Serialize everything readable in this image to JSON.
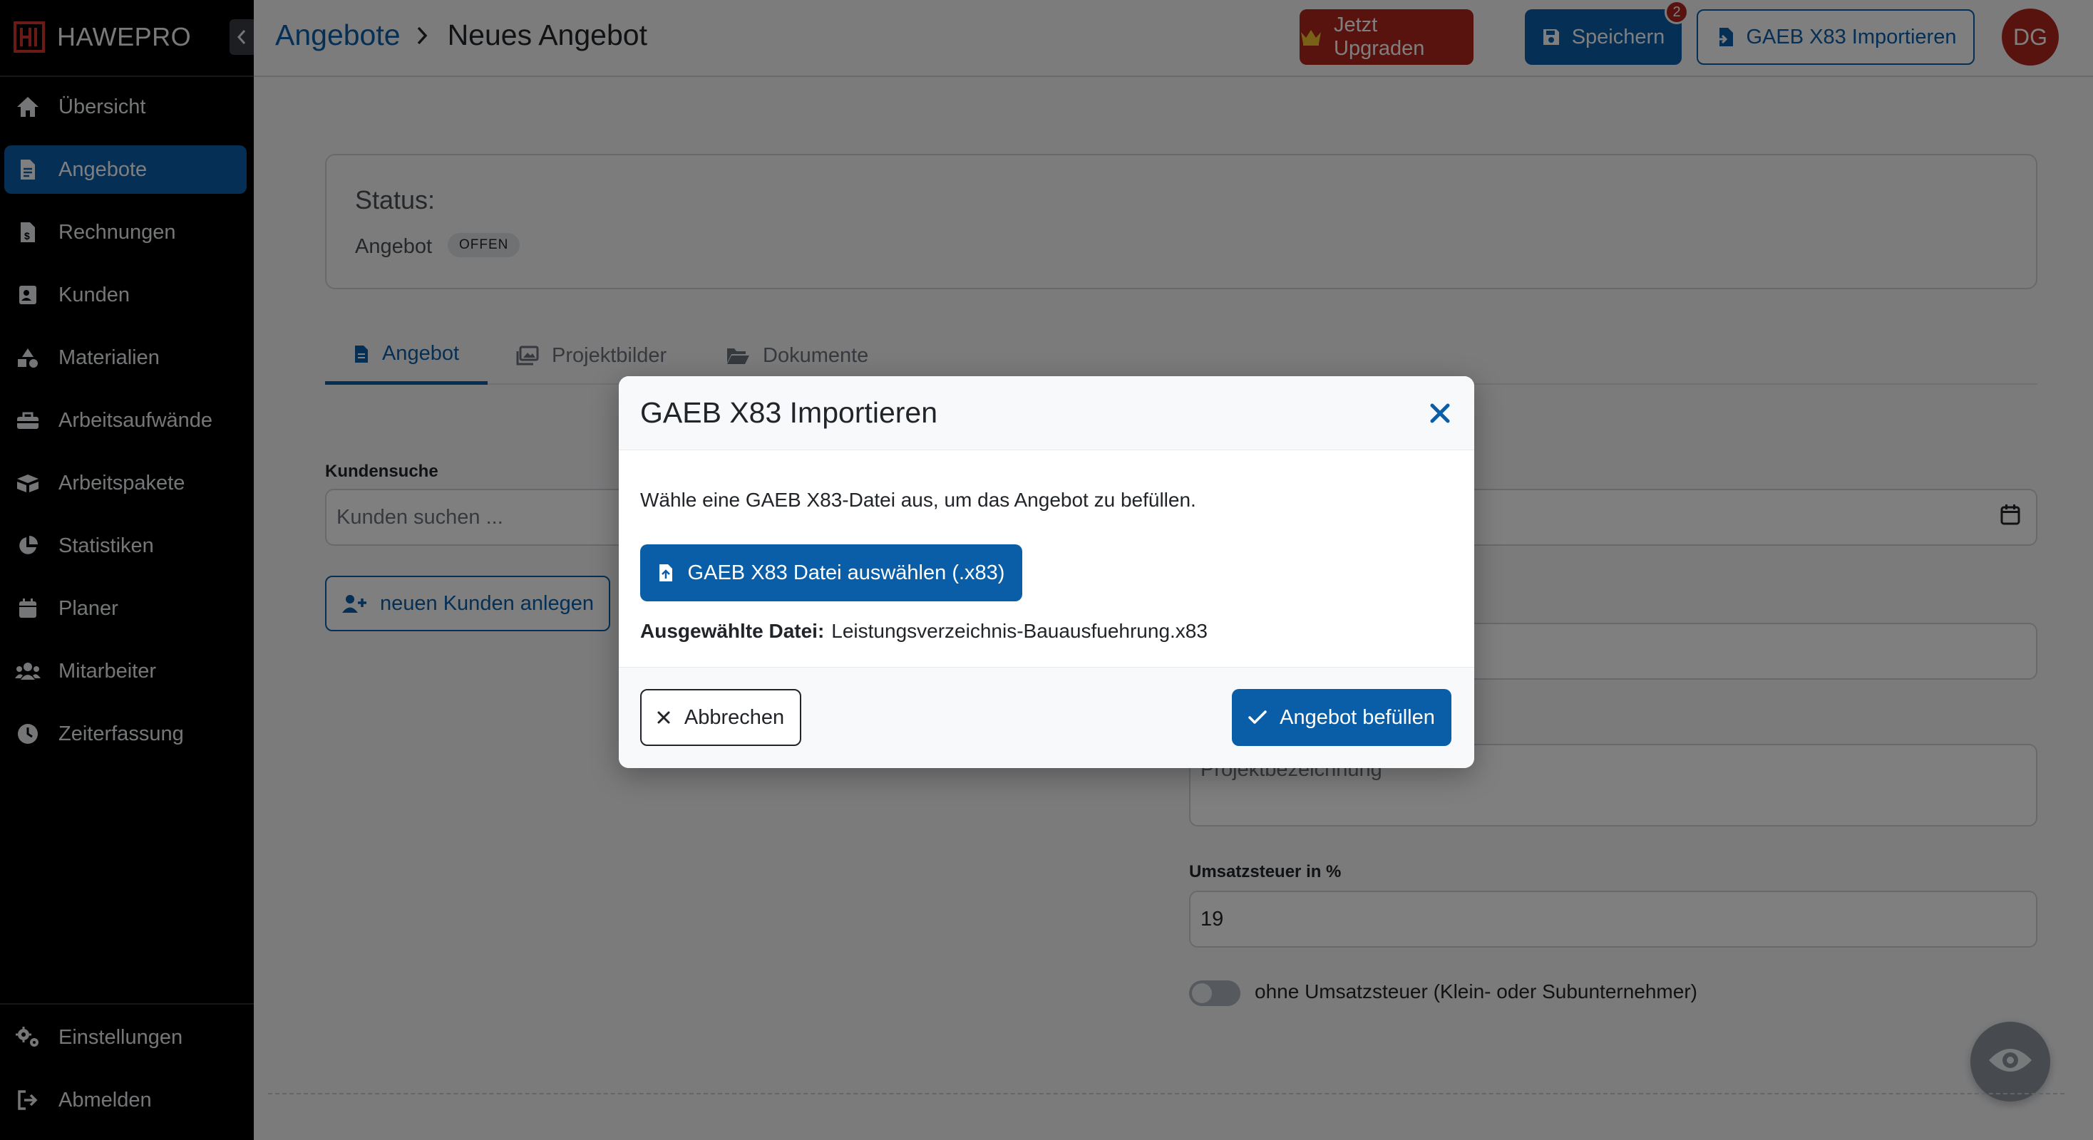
{
  "app": {
    "brand_name": "HAWEPRO"
  },
  "sidebar": {
    "items": [
      {
        "label": "Übersicht",
        "icon": "home-icon"
      },
      {
        "label": "Angebote",
        "icon": "file-icon",
        "active": true
      },
      {
        "label": "Rechnungen",
        "icon": "invoice-icon"
      },
      {
        "label": "Kunden",
        "icon": "contact-card-icon"
      },
      {
        "label": "Materialien",
        "icon": "shapes-icon"
      },
      {
        "label": "Arbeitsaufwände",
        "icon": "toolbox-icon"
      },
      {
        "label": "Arbeitspakete",
        "icon": "boxes-icon"
      },
      {
        "label": "Statistiken",
        "icon": "pie-chart-icon"
      },
      {
        "label": "Planer",
        "icon": "calendar-icon"
      },
      {
        "label": "Mitarbeiter",
        "icon": "users-icon"
      },
      {
        "label": "Zeiterfassung",
        "icon": "clock-icon"
      }
    ],
    "bottom_items": [
      {
        "label": "Einstellungen",
        "icon": "gears-icon"
      },
      {
        "label": "Abmelden",
        "icon": "logout-icon"
      }
    ]
  },
  "header": {
    "breadcrumb_parent": "Angebote",
    "breadcrumb_current": "Neues Angebot",
    "upgrade_label": "Jetzt Upgraden",
    "save_label": "Speichern",
    "save_badge": "2",
    "gaeb_import_label": "GAEB X83 Importieren",
    "avatar_initials": "DG"
  },
  "status": {
    "title": "Status:",
    "type": "Angebot",
    "badge": "OFFEN"
  },
  "tabs": [
    {
      "label": "Angebot",
      "active": true
    },
    {
      "label": "Projektbilder"
    },
    {
      "label": "Dokumente"
    }
  ],
  "form": {
    "customer_search_label": "Kundensuche",
    "customer_search_placeholder": "Kunden suchen ...",
    "new_customer_label": "neuen Kunden anlegen",
    "project_placeholder": "Projektbezeichnung",
    "vat_label": "Umsatzsteuer in %",
    "vat_value": "19",
    "no_vat_label": "ohne Umsatzsteuer (Klein- oder Subunternehmer)"
  },
  "modal": {
    "title": "GAEB X83 Importieren",
    "description": "Wähle eine GAEB X83-Datei aus, um das Angebot zu befüllen.",
    "choose_file_label": "GAEB X83 Datei auswählen (.x83)",
    "selected_file_label": "Ausgewählte Datei:",
    "selected_file_name": "Leistungsverzeichnis-Bauausfuehrung.x83",
    "cancel_label": "Abbrechen",
    "confirm_label": "Angebot befüllen"
  },
  "colors": {
    "primary": "#0a5ea8",
    "danger": "#b3261e",
    "sidebar_bg": "#000000"
  }
}
